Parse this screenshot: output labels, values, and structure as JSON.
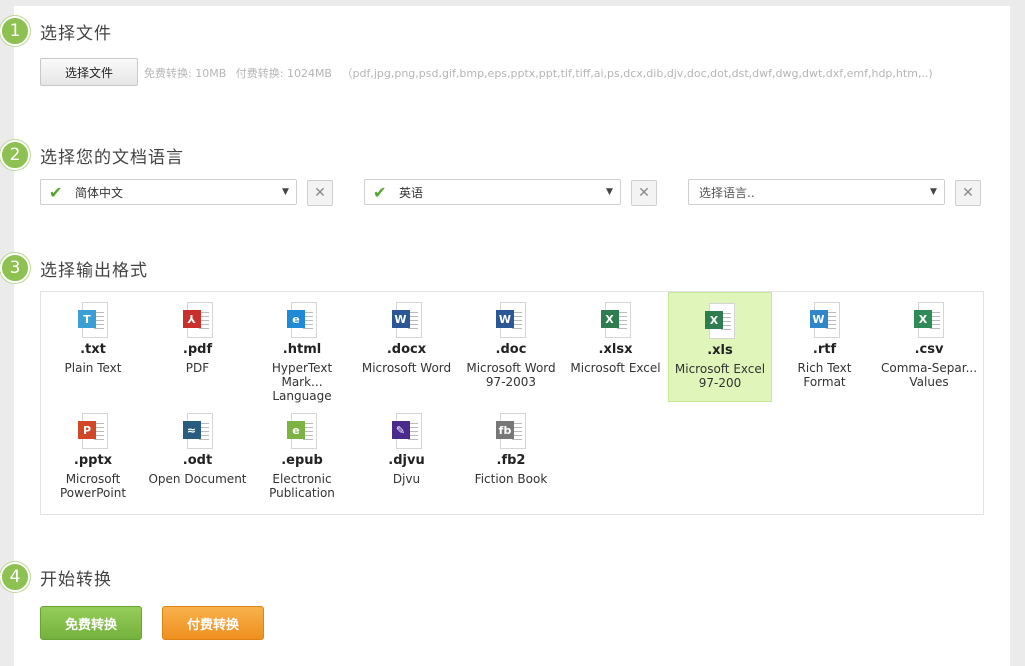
{
  "steps": [
    {
      "num": "1",
      "title": "选择文件"
    },
    {
      "num": "2",
      "title": "选择您的文档语言"
    },
    {
      "num": "3",
      "title": "选择输出格式"
    },
    {
      "num": "4",
      "title": "开始转换"
    }
  ],
  "upload": {
    "button_label": "选择文件",
    "free_limit": "免费转换: 10MB",
    "paid_limit": "付费转换: 1024MB",
    "supported": "（pdf,jpg,png,psd,gif,bmp,eps,pptx,ppt,tif,tiff,ai,ps,dcx,dib,djv,doc,dot,dst,dwf,dwg,dwt,dxf,emf,hdp,htm,..)"
  },
  "languages": [
    {
      "value": "简体中文",
      "checked": true
    },
    {
      "value": "英语",
      "checked": true
    },
    {
      "value": "",
      "placeholder": "选择语言..",
      "checked": false
    }
  ],
  "clear_glyph": "✕",
  "formats": [
    {
      "ext": ".txt",
      "desc": "Plain Text",
      "badge": "T",
      "color": "#3b9ed4",
      "icon": "txt-file-icon"
    },
    {
      "ext": ".pdf",
      "desc": "PDF",
      "badge": "⅄",
      "color": "#c9302c",
      "icon": "pdf-file-icon"
    },
    {
      "ext": ".html",
      "desc": "HyperText Mark... Language",
      "badge": "e",
      "color": "#1f8bd6",
      "icon": "html-file-icon"
    },
    {
      "ext": ".docx",
      "desc": "Microsoft Word",
      "badge": "W",
      "color": "#2b5797",
      "icon": "docx-file-icon"
    },
    {
      "ext": ".doc",
      "desc": "Microsoft Word 97-2003",
      "badge": "W",
      "color": "#2b5797",
      "icon": "doc-file-icon"
    },
    {
      "ext": ".xlsx",
      "desc": "Microsoft Excel",
      "badge": "X",
      "color": "#2e7d4f",
      "icon": "xlsx-file-icon"
    },
    {
      "ext": ".xls",
      "desc": "Microsoft Excel 97-200",
      "badge": "X",
      "color": "#2e7d4f",
      "icon": "xls-file-icon",
      "selected": true
    },
    {
      "ext": ".rtf",
      "desc": "Rich Text Format",
      "badge": "W",
      "color": "#2f86c9",
      "icon": "rtf-file-icon"
    },
    {
      "ext": ".csv",
      "desc": "Comma-Separ... Values",
      "badge": "X",
      "color": "#2e8b57",
      "icon": "csv-file-icon"
    },
    {
      "ext": ".pptx",
      "desc": "Microsoft PowerPoint",
      "badge": "P",
      "color": "#d24726",
      "icon": "pptx-file-icon"
    },
    {
      "ext": ".odt",
      "desc": "Open Document",
      "badge": "≈",
      "color": "#285d80",
      "icon": "odt-file-icon"
    },
    {
      "ext": ".epub",
      "desc": "Electronic Publication",
      "badge": "e",
      "color": "#7cb342",
      "icon": "epub-file-icon"
    },
    {
      "ext": ".djvu",
      "desc": "Djvu",
      "badge": "✎",
      "color": "#4a2a8c",
      "icon": "djvu-file-icon"
    },
    {
      "ext": ".fb2",
      "desc": "Fiction Book",
      "badge": "fb",
      "color": "#777777",
      "icon": "fb2-file-icon"
    }
  ],
  "actions": {
    "free": "免费转换",
    "paid": "付费转换"
  },
  "colors": {
    "accent_green": "#8dc152",
    "selected_bg": "#dff5b9",
    "paid_orange": "#ef8f1f"
  }
}
